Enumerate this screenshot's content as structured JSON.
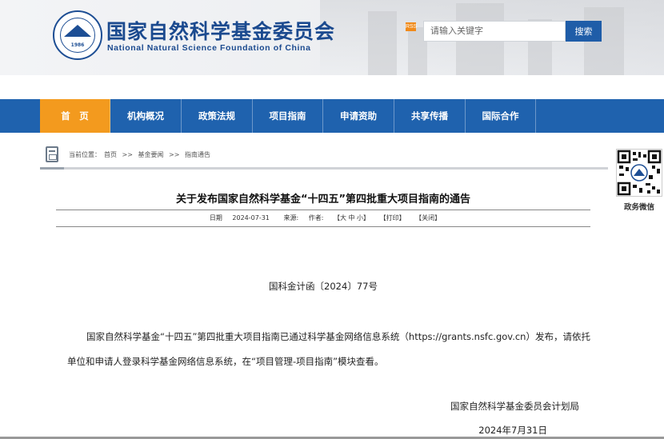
{
  "header": {
    "org_name_cn": "国家自然科学基金委员会",
    "org_name_en": "National Natural Science Foundation of China",
    "logo_year": "1986",
    "rss_label": "RSS",
    "search_placeholder": "请输入关键字",
    "search_button": "搜索"
  },
  "nav": {
    "items": [
      "首　页",
      "机构概况",
      "政策法规",
      "项目指南",
      "申请资助",
      "共享传播",
      "国际合作"
    ],
    "active_index": 0,
    "active_color": "#f39a1e",
    "bar_color": "#1f62ae"
  },
  "breadcrumb": {
    "prefix": "当前位置：",
    "items": [
      "首页",
      ">>",
      "基金要闻",
      ">>",
      "指南通告"
    ]
  },
  "qr": {
    "label": "政务微信"
  },
  "article": {
    "title": "关于发布国家自然科学基金“十四五”第四批重大项目指南的通告",
    "meta": {
      "date_label": "日期",
      "date": "2024-07-31",
      "source_label": "来源:",
      "author_label": "作者:",
      "font_size": "【大 中 小】",
      "print": "【打印】",
      "close": "【关闭】"
    },
    "doc_number": "国科金计函〔2024〕77号",
    "body": "国家自然科学基金“十四五”第四批重大项目指南已通过科学基金网络信息系统（https://grants.nsfc.gov.cn）发布，请依托单位和申请人登录科学基金网络信息系统，在“项目管理-项目指南”模块查看。",
    "signature": "国家自然科学基金委员会计划局",
    "sign_date": "2024年7月31日"
  }
}
